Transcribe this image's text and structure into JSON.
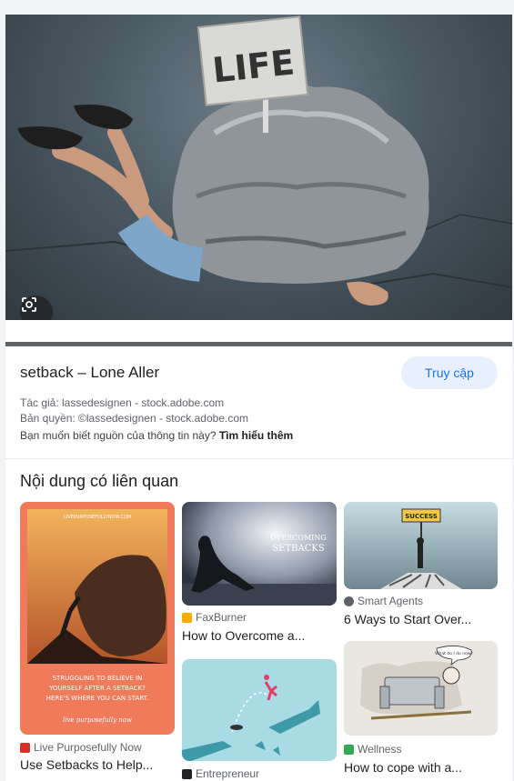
{
  "hero": {
    "sign_text": "LIFE"
  },
  "info": {
    "title": "setback – Lone Aller",
    "visit_label": "Truy cập",
    "author": "Tác giả: lassedesignen - stock.adobe.com",
    "copyright": "Bản quyền: ©lassedesignen - stock.adobe.com",
    "source_question": "Bạn muốn biết nguồn của thông tin này?",
    "learn_more": "Tìm hiểu thêm"
  },
  "related": {
    "heading": "Nội dung có liên quan",
    "items": [
      {
        "source": "Live Purposefully Now",
        "caption": "Use Setbacks to Help...",
        "favicon_color": "#d93025",
        "image_text": [
          "LIVEPURPOSEFULLYNOW.COM",
          "STRUGGLING TO BELIEVE IN",
          "YOURSELF AFTER A SETBACK?",
          "HERE'S WHERE YOU CAN START.",
          "live purposefully now"
        ]
      },
      {
        "source": "FaxBurner",
        "caption": "How to Overcome a...",
        "favicon_color": "#f9ab00",
        "image_text": [
          "OVERCOMING",
          "SETBACKS"
        ]
      },
      {
        "source": "Smart Agents",
        "caption": "6 Ways to Start Over...",
        "favicon_color": "#5f6368",
        "image_text": [
          "SUCCESS"
        ]
      },
      {
        "source": "Entrepreneur",
        "caption": "",
        "favicon_color": "#202124",
        "image_text": []
      },
      {
        "source": "Wellness",
        "caption": "How to cope with a...",
        "favicon_color": "#34a853",
        "image_text": [
          "What do I do now?"
        ]
      }
    ]
  }
}
